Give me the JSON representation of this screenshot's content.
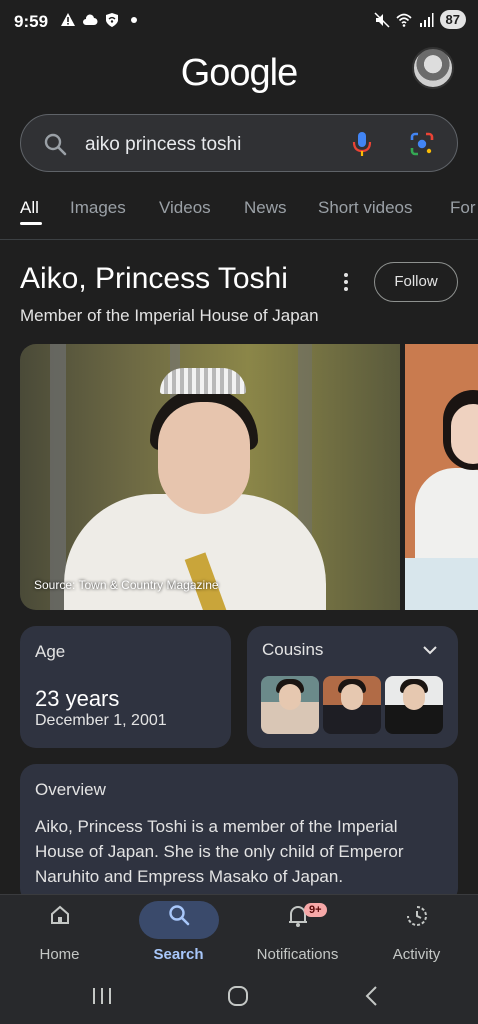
{
  "status_bar": {
    "time": "9:59",
    "battery": "87",
    "icons": [
      "warning-icon",
      "cloud-icon",
      "vpn-icon",
      "dot-icon",
      "mute-icon",
      "wifi-icon",
      "signal-icon"
    ]
  },
  "header": {
    "logo": "Google"
  },
  "search": {
    "query": "aiko princess toshi"
  },
  "tabs": [
    {
      "label": "All",
      "active": true
    },
    {
      "label": "Images"
    },
    {
      "label": "Videos"
    },
    {
      "label": "News"
    },
    {
      "label": "Short videos"
    },
    {
      "label": "For"
    }
  ],
  "entity": {
    "title": "Aiko, Princess Toshi",
    "subtitle": "Member of the Imperial House of Japan",
    "follow_label": "Follow",
    "image_caption": "Source: Town & Country Magazine"
  },
  "age_card": {
    "label": "Age",
    "value": "23 years",
    "date": "December 1, 2001"
  },
  "cousins_card": {
    "label": "Cousins"
  },
  "overview": {
    "label": "Overview",
    "text": "Aiko, Princess Toshi is a member of the Imperial House of Japan. She is the only child of Emperor Naruhito and Empress Masako of Japan."
  },
  "bottom_nav": {
    "items": [
      {
        "label": "Home",
        "icon": "home-icon"
      },
      {
        "label": "Search",
        "icon": "search-icon",
        "active": true
      },
      {
        "label": "Notifications",
        "icon": "bell-icon",
        "badge": "9+"
      },
      {
        "label": "Activity",
        "icon": "activity-icon"
      }
    ]
  },
  "colors": {
    "background": "#1f1f1f",
    "card": "#2f3340",
    "accent": "#a8c7fa"
  }
}
